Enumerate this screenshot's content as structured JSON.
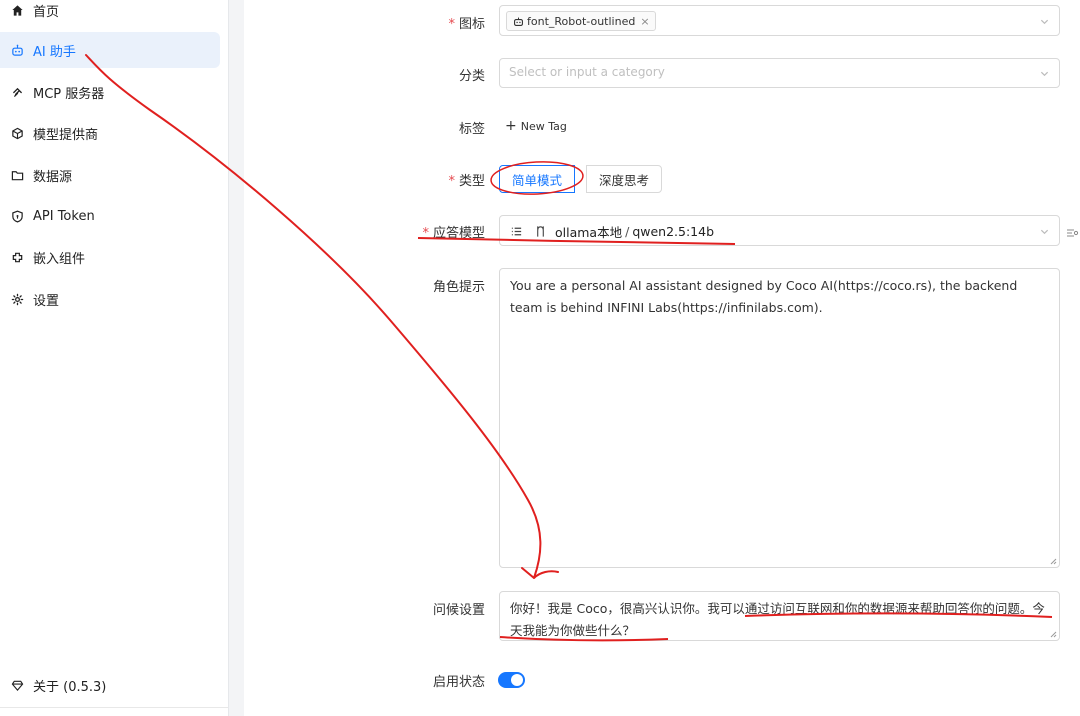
{
  "sidebar": {
    "items": [
      {
        "label": "首页",
        "icon": "home-icon"
      },
      {
        "label": "AI 助手",
        "icon": "robot-icon"
      },
      {
        "label": "MCP 服务器",
        "icon": "mcp-icon"
      },
      {
        "label": "模型提供商",
        "icon": "model-provider-icon"
      },
      {
        "label": "数据源",
        "icon": "folder-icon"
      },
      {
        "label": "API Token",
        "icon": "shield-icon"
      },
      {
        "label": "嵌入组件",
        "icon": "embed-icon"
      },
      {
        "label": "设置",
        "icon": "gear-icon"
      }
    ],
    "active": "AI 助手",
    "about": "关于 (0.5.3)"
  },
  "form": {
    "required_mark": "*",
    "icon": {
      "label": "图标",
      "value": "font_Robot-outlined"
    },
    "category": {
      "label": "分类",
      "placeholder": "Select or input a category"
    },
    "tags": {
      "label": "标签",
      "new_tag": "New Tag"
    },
    "type": {
      "label": "类型",
      "options": [
        "简单模式",
        "深度思考"
      ],
      "selected": "简单模式"
    },
    "answer_model": {
      "label": "应答模型",
      "provider": "ollama本地",
      "separator": "/",
      "model": "qwen2.5:14b"
    },
    "role_prompt": {
      "label": "角色提示",
      "value": "You are a personal AI assistant designed by Coco AI(https://coco.rs), the backend team is behind INFINI Labs(https://infinilabs.com)."
    },
    "greeting": {
      "label": "问候设置",
      "value": "你好！我是 Coco，很高兴认识你。我可以通过访问互联网和你的数据源来帮助回答你的问题。今天我能为你做些什么？"
    },
    "enabled": {
      "label": "启用状态",
      "on": true
    }
  },
  "colors": {
    "accent": "#1677ff",
    "annotation": "#e0201f",
    "required": "#e5484d"
  }
}
